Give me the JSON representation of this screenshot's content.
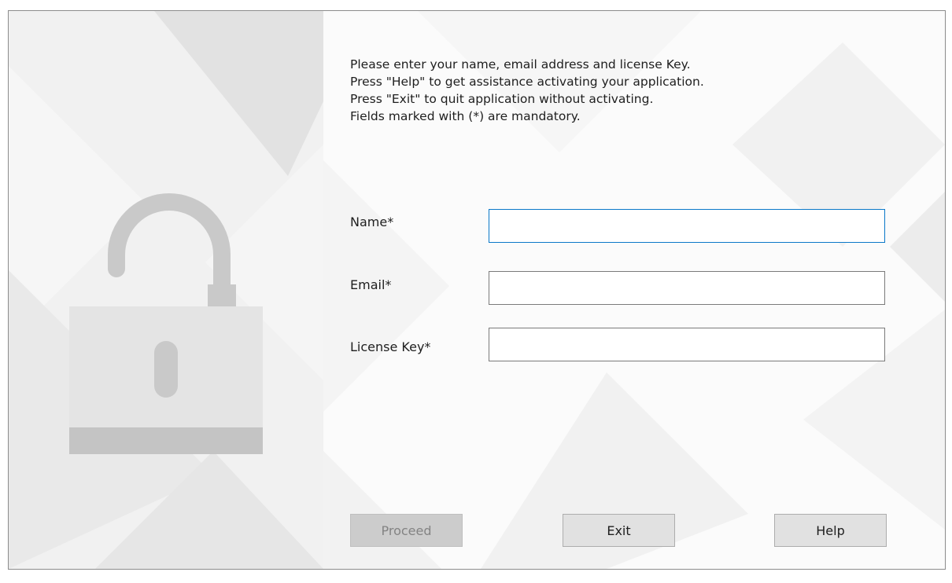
{
  "instructions": {
    "line1": "Please enter your name, email address and license Key.",
    "line2": "Press \"Help\" to get assistance activating your application.",
    "line3": "Press \"Exit\" to quit application without activating.",
    "line4": "Fields marked with (*) are mandatory."
  },
  "form": {
    "name_label": "Name*",
    "name_value": "",
    "email_label": "Email*",
    "email_value": "",
    "license_label": "License Key*",
    "license_value": ""
  },
  "buttons": {
    "proceed": "Proceed",
    "proceed_enabled": false,
    "exit": "Exit",
    "help": "Help"
  },
  "icons": {
    "lock": "unlocked-padlock-icon"
  },
  "colors": {
    "focus_border": "#0a78c8",
    "lock_body": "#e4e4e4",
    "lock_shackle": "#c9c9c9"
  }
}
